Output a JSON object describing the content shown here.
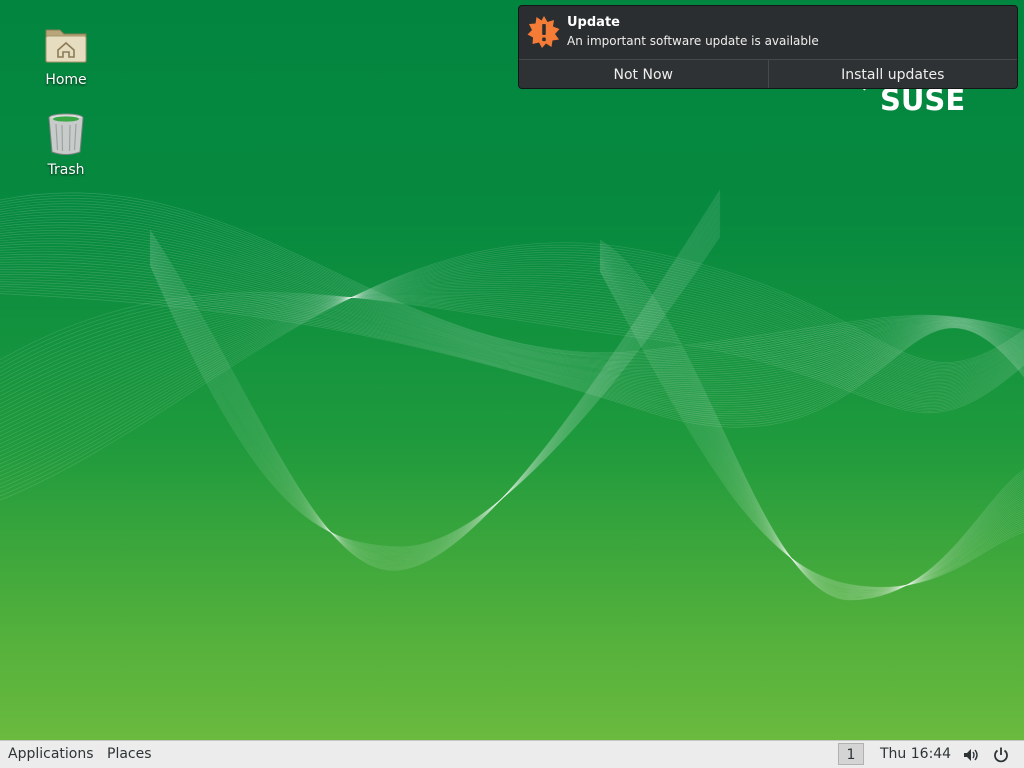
{
  "desktop": {
    "icons": [
      {
        "label": "Home",
        "icon": "home-folder-icon"
      },
      {
        "label": "Trash",
        "icon": "trash-icon"
      }
    ],
    "logo_text": "SUSE"
  },
  "notification": {
    "title": "Update",
    "body": "An important software update is available",
    "icon": "update-warning-icon",
    "icon_color": "#f57c37",
    "actions": [
      {
        "label": "Not Now"
      },
      {
        "label": "Install updates"
      }
    ]
  },
  "panel": {
    "menus": [
      {
        "label": "Applications"
      },
      {
        "label": "Places"
      }
    ],
    "workspace": "1",
    "clock": "Thu 16:44",
    "icons": [
      "volume-icon",
      "power-icon"
    ]
  },
  "colors": {
    "desktop_top": "#02853f",
    "desktop_bottom": "#6aba3e",
    "panel_bg": "#ececec",
    "notification_bg": "#2b2e30"
  }
}
